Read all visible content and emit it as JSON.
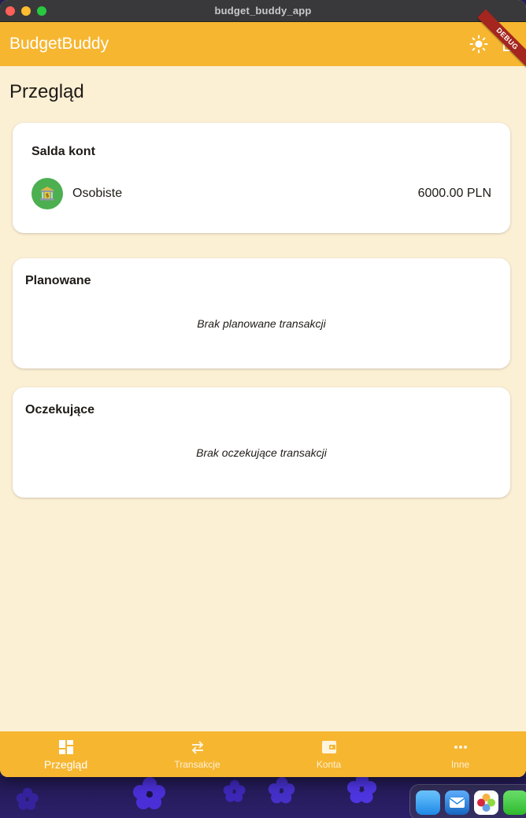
{
  "window": {
    "title": "budget_buddy_app"
  },
  "appbar": {
    "title": "BudgetBuddy",
    "theme_icon": "sun-icon",
    "logout_icon": "logout-icon",
    "debug_banner": "DEBUG"
  },
  "page": {
    "title": "Przegląd"
  },
  "balances": {
    "heading": "Salda kont",
    "accounts": [
      {
        "name": "Osobiste",
        "balance": "6000.00 PLN",
        "icon": "bank-icon"
      }
    ]
  },
  "planned": {
    "heading": "Planowane",
    "empty_text": "Brak planowane transakcji"
  },
  "pending": {
    "heading": "Oczekujące",
    "empty_text": "Brak oczekujące transakcji"
  },
  "bottom_nav": {
    "items": [
      {
        "label": "Przegląd",
        "icon": "dashboard-icon",
        "active": true
      },
      {
        "label": "Transakcje",
        "icon": "swap-icon",
        "active": false
      },
      {
        "label": "Konta",
        "icon": "wallet-icon",
        "active": false
      },
      {
        "label": "Inne",
        "icon": "more-icon",
        "active": false
      }
    ]
  },
  "colors": {
    "primary": "#f6b630",
    "background": "#fbefd4",
    "card": "#ffffff",
    "account_avatar": "#4caf50",
    "debug_banner": "#a4261f"
  }
}
